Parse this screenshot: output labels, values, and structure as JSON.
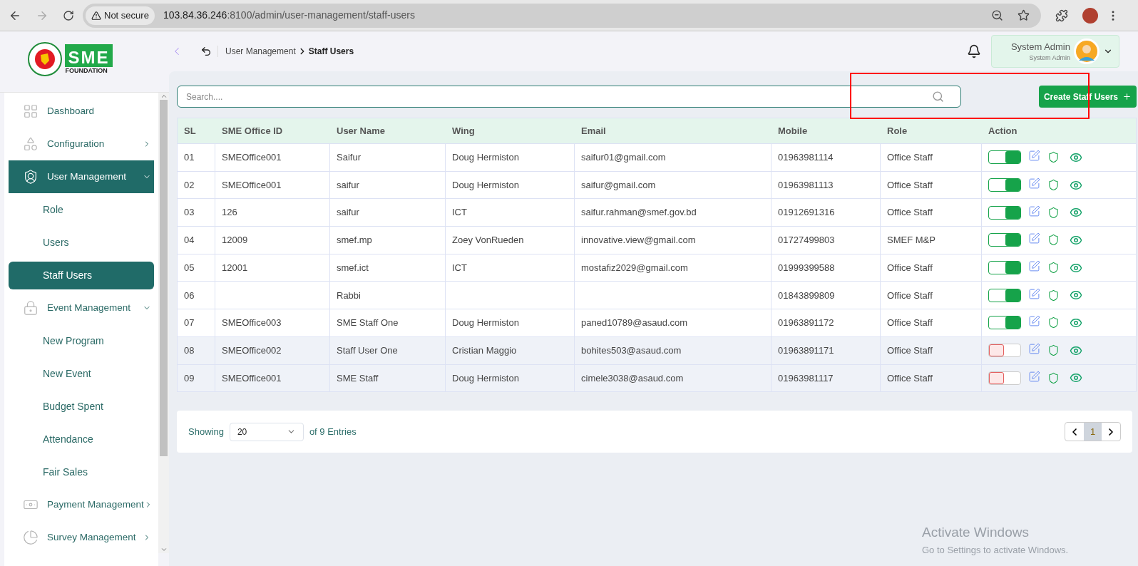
{
  "browser": {
    "security": "Not secure",
    "url_host": "103.84.36.246",
    "url_rest": ":8100/admin/user-management/staff-users"
  },
  "logo": {
    "mark": "SME",
    "subtitle": "FOUNDATION"
  },
  "sidebar": {
    "items": [
      {
        "label": "Dashboard",
        "selected": false
      },
      {
        "label": "Configuration",
        "selected": false,
        "expanded": false
      },
      {
        "label": "User Management",
        "selected": true,
        "expanded": true,
        "children": [
          {
            "label": "Role",
            "selected": false
          },
          {
            "label": "Users",
            "selected": false
          },
          {
            "label": "Staff Users",
            "selected": true
          }
        ]
      },
      {
        "label": "Event Management",
        "selected": false,
        "expanded": true,
        "children": [
          {
            "label": "New Program",
            "selected": false
          },
          {
            "label": "New Event",
            "selected": false
          },
          {
            "label": "Budget Spent",
            "selected": false
          },
          {
            "label": "Attendance",
            "selected": false
          },
          {
            "label": "Fair Sales",
            "selected": false
          }
        ]
      },
      {
        "label": "Payment Management",
        "selected": false,
        "expanded": false
      },
      {
        "label": "Survey Management",
        "selected": false,
        "expanded": false
      }
    ]
  },
  "breadcrumb": {
    "parent": "User Management",
    "current": "Staff Users"
  },
  "user": {
    "name": "System Admin",
    "role": "System Admin"
  },
  "search": {
    "placeholder": "Search...."
  },
  "create_button": "Create Staff Users",
  "table": {
    "columns": [
      "SL",
      "SME Office ID",
      "User Name",
      "Wing",
      "Email",
      "Mobile",
      "Role",
      "Action"
    ],
    "rows": [
      {
        "sl": "01",
        "office_id": "SMEOffice001",
        "user_name": "Saifur",
        "wing": "Doug Hermiston",
        "email": "saifur01@gmail.com",
        "mobile": "01963981114",
        "role": "Office Staff",
        "active": true
      },
      {
        "sl": "02",
        "office_id": "SMEOffice001",
        "user_name": "saifur",
        "wing": "Doug Hermiston",
        "email": "saifur@gmail.com",
        "mobile": "01963981113",
        "role": "Office Staff",
        "active": true
      },
      {
        "sl": "03",
        "office_id": "126",
        "user_name": "saifur",
        "wing": "ICT",
        "email": "saifur.rahman@smef.gov.bd",
        "mobile": "01912691316",
        "role": "Office Staff",
        "active": true
      },
      {
        "sl": "04",
        "office_id": "12009",
        "user_name": "smef.mp",
        "wing": "Zoey VonRueden",
        "email": "innovative.view@gmail.com",
        "mobile": "01727499803",
        "role": "SMEF M&P",
        "active": true
      },
      {
        "sl": "05",
        "office_id": "12001",
        "user_name": "smef.ict",
        "wing": "ICT",
        "email": "mostafiz2029@gmail.com",
        "mobile": "01999399588",
        "role": "Office Staff",
        "active": true
      },
      {
        "sl": "06",
        "office_id": "",
        "user_name": "Rabbi",
        "wing": "",
        "email": "",
        "mobile": "01843899809",
        "role": "Office Staff",
        "active": true
      },
      {
        "sl": "07",
        "office_id": "SMEOffice003",
        "user_name": "SME Staff One",
        "wing": "Doug Hermiston",
        "email": "paned10789@asaud.com",
        "mobile": "01963891172",
        "role": "Office Staff",
        "active": true
      },
      {
        "sl": "08",
        "office_id": "SMEOffice002",
        "user_name": "Staff User One",
        "wing": "Cristian Maggio",
        "email": "bohites503@asaud.com",
        "mobile": "01963891171",
        "role": "Office Staff",
        "active": false
      },
      {
        "sl": "09",
        "office_id": "SMEOffice001",
        "user_name": "SME Staff",
        "wing": "Doug Hermiston",
        "email": "cimele3038@asaud.com",
        "mobile": "01963981117",
        "role": "Office Staff",
        "active": false
      }
    ]
  },
  "footer": {
    "showing": "Showing",
    "page_size": "20",
    "entries": "of 9 Entries",
    "pages": [
      {
        "label": "1",
        "selected": true
      }
    ]
  },
  "os_watermark": {
    "title": "Activate Windows",
    "subtitle": "Go to Settings to activate Windows."
  }
}
